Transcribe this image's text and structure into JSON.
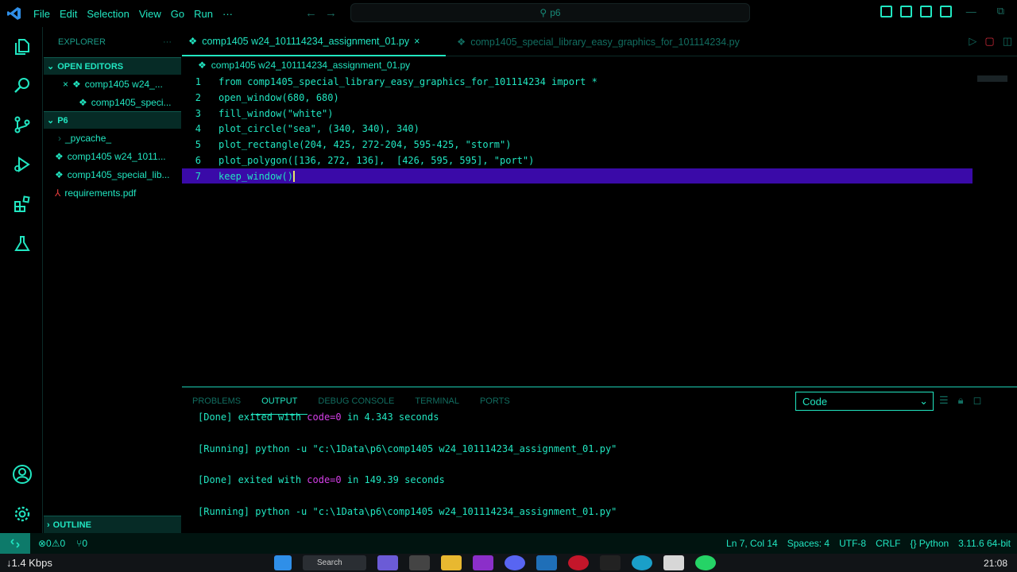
{
  "menu": [
    "File",
    "Edit",
    "Selection",
    "View",
    "Go",
    "Run",
    "···"
  ],
  "search": {
    "text": "p6"
  },
  "sidebar": {
    "title": "EXPLORER",
    "more": "···",
    "open_editors_label": "OPEN EDITORS",
    "open_editors": [
      {
        "name": "comp1405 w24_...",
        "close": "×"
      },
      {
        "name": "comp1405_speci..."
      }
    ],
    "folder_label": "P6",
    "files": [
      {
        "name": "_pycache_"
      },
      {
        "name": "comp1405 w24_1011..."
      },
      {
        "name": "comp1405_special_lib..."
      },
      {
        "name": "requirements.pdf"
      }
    ],
    "outline_label": "OUTLINE"
  },
  "tabs": [
    {
      "label": "comp1405 w24_101114234_assignment_01.py",
      "close": "×"
    },
    {
      "label": "comp1405_special_library_easy_graphics_for_101114234.py"
    }
  ],
  "breadcrumb": "comp1405 w24_101114234_assignment_01.py",
  "code": {
    "line_numbers": [
      "1",
      "2",
      "3",
      "4",
      "5",
      "6",
      "7"
    ],
    "lines": [
      "from comp1405_special_library_easy_graphics_for_101114234 import *",
      "open_window(680, 680)",
      "fill_window(\"white\")",
      "plot_circle(\"sea\", (340, 340), 340)",
      "plot_rectangle(204, 425, 272-204, 595-425, \"storm\")",
      "plot_polygon([136, 272, 136],  [426, 595, 595], \"port\")",
      "keep_window()"
    ]
  },
  "panel": {
    "tabs": [
      "PROBLEMS",
      "OUTPUT",
      "DEBUG CONSOLE",
      "TERMINAL",
      "PORTS"
    ],
    "active_tab": "OUTPUT",
    "select_value": "Code",
    "output": [
      {
        "pre": "[Done] exited with ",
        "code": "code=0",
        "post": " in 4.343 seconds"
      },
      {
        "pre": "[Running] python -u \"c:\\1Data\\p6\\comp1405 w24_101114234_assignment_01.py\"",
        "code": "",
        "post": ""
      },
      {
        "pre": "[Done] exited with ",
        "code": "code=0",
        "post": " in 149.39 seconds"
      },
      {
        "pre": "[Running] python -u \"c:\\1Data\\p6\\comp1405 w24_101114234_assignment_01.py\"",
        "code": "",
        "post": ""
      }
    ]
  },
  "statusbar": {
    "errors": "⊗0⚠0",
    "ports": "⑂0",
    "position": "Ln 7, Col 14",
    "spaces": "Spaces: 4",
    "encoding": "UTF-8",
    "eol": "CRLF",
    "language": "{} Python",
    "interpreter": "3.11.6 64-bit"
  },
  "taskbar": {
    "network": "↓1.4 Kbps",
    "search": "Search",
    "time": "21:08"
  },
  "colors": {
    "accent": "#21e6c1",
    "current_line": "#3a0aa8",
    "number": "#e6e66a",
    "exit_code": "#d53fe8"
  }
}
